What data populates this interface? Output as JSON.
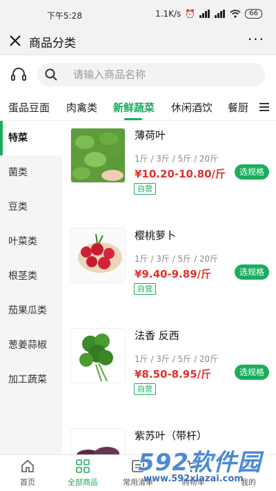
{
  "status_bar": {
    "time": "下午5:28",
    "network_speed": "1.1K/s",
    "battery": "66"
  },
  "titlebar": {
    "title": "商品分类",
    "more": "···"
  },
  "search": {
    "placeholder": "请输入商品名称"
  },
  "tabs": [
    {
      "label": "蛋品豆面"
    },
    {
      "label": "肉禽类"
    },
    {
      "label": "新鲜蔬菜"
    },
    {
      "label": "休闲酒饮"
    },
    {
      "label": "餐厨"
    }
  ],
  "active_tab": "新鲜蔬菜",
  "sidebar": [
    {
      "label": "特菜"
    },
    {
      "label": "菌类"
    },
    {
      "label": "豆类"
    },
    {
      "label": "叶菜类"
    },
    {
      "label": "根茎类"
    },
    {
      "label": "茄果瓜类"
    },
    {
      "label": "葱姜蒜椒"
    },
    {
      "label": "加工蔬菜"
    }
  ],
  "active_sidebar": "特菜",
  "products": [
    {
      "name": "薄荷叶",
      "specs": "1斤 / 3斤 / 5斤 / 20斤",
      "price": "¥10.20-10.80/斤",
      "badge": "自营",
      "button": "选规格"
    },
    {
      "name": "樱桃萝卜",
      "specs": "1斤 / 3斤 / 5斤 / 20斤",
      "price": "¥9.40-9.89/斤",
      "badge": "自营",
      "button": "选规格"
    },
    {
      "name": "法香 反西",
      "specs": "1斤 / 3斤 / 5斤 / 20斤",
      "price": "¥8.50-8.95/斤",
      "badge": "自营",
      "button": "选规格"
    },
    {
      "name": "紫苏叶（带杆）"
    }
  ],
  "bottom_nav": [
    {
      "label": "首页",
      "icon": "home-icon"
    },
    {
      "label": "全部商品",
      "icon": "grid-icon"
    },
    {
      "label": "常用清单",
      "icon": "list-icon"
    },
    {
      "label": "购物车",
      "icon": "cart-icon"
    },
    {
      "label": "我的",
      "icon": "user-icon"
    }
  ],
  "watermark": {
    "brand": "592软件园",
    "url": "www.592xiazai.com"
  },
  "colors": {
    "accent": "#1aad5c",
    "price": "#e0302a"
  }
}
